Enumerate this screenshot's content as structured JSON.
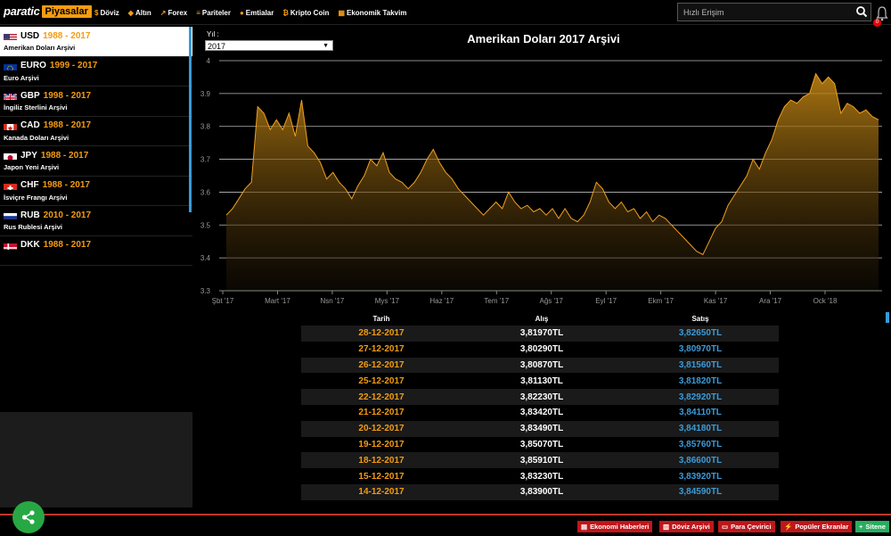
{
  "brand": {
    "part1": "paratic",
    "part2": "Piyasalar"
  },
  "nav": [
    {
      "icon": "dollar-icon",
      "glyph": "$",
      "label": "Döviz"
    },
    {
      "icon": "gold-icon",
      "glyph": "◆",
      "label": "Altın"
    },
    {
      "icon": "forex-icon",
      "glyph": "↗",
      "label": "Forex"
    },
    {
      "icon": "parity-icon",
      "glyph": "≡",
      "label": "Pariteler"
    },
    {
      "icon": "commodity-icon",
      "glyph": "●",
      "label": "Emtialar"
    },
    {
      "icon": "bitcoin-icon",
      "glyph": "₿",
      "label": "Kripto Coin"
    },
    {
      "icon": "calendar-icon",
      "glyph": "▦",
      "label": "Ekonomik Takvim"
    }
  ],
  "search": {
    "placeholder": "Hızlı Erişim"
  },
  "notifications": {
    "count": "0"
  },
  "sidebar": {
    "items": [
      {
        "flag": "us",
        "code": "USD",
        "years": "1988 - 2017",
        "name": "Amerikan Doları Arşivi",
        "active": true
      },
      {
        "flag": "eu",
        "code": "EURO",
        "years": "1999 - 2017",
        "name": "Euro Arşivi"
      },
      {
        "flag": "gb",
        "code": "GBP",
        "years": "1998 - 2017",
        "name": "İngiliz Sterlini Arşivi"
      },
      {
        "flag": "ca",
        "code": "CAD",
        "years": "1988 - 2017",
        "name": "Kanada Doları Arşivi"
      },
      {
        "flag": "jp",
        "code": "JPY",
        "years": "1988 - 2017",
        "name": "Japon Yeni Arşivi"
      },
      {
        "flag": "ch",
        "code": "CHF",
        "years": "1988 - 2017",
        "name": "İsviçre Frangı Arşivi"
      },
      {
        "flag": "ru",
        "code": "RUB",
        "years": "2010 - 2017",
        "name": "Rus Rublesi Arşivi"
      },
      {
        "flag": "dk",
        "code": "DKK",
        "years": "1988 - 2017",
        "name": ""
      }
    ]
  },
  "year_select": {
    "label": "Yıl :",
    "value": "2017"
  },
  "chart_data": {
    "type": "area",
    "title": "Amerikan Doları 2017 Arşivi",
    "ylim": [
      3.3,
      4.0
    ],
    "yticks": [
      "3.3",
      "3.4",
      "3.5",
      "3.6",
      "3.7",
      "3.8",
      "3.9",
      "4"
    ],
    "xticks": [
      "Şbt '17",
      "Mart '17",
      "Nsn '17",
      "Mys '17",
      "Haz '17",
      "Tem '17",
      "Ağs '17",
      "Eyl '17",
      "Ekm '17",
      "Kas '17",
      "Ara '17",
      "Ock '18"
    ],
    "grid": true,
    "series": [
      {
        "values": [
          3.53,
          3.55,
          3.58,
          3.61,
          3.63,
          3.86,
          3.84,
          3.79,
          3.82,
          3.79,
          3.84,
          3.77,
          3.88,
          3.74,
          3.72,
          3.69,
          3.64,
          3.66,
          3.63,
          3.61,
          3.58,
          3.62,
          3.65,
          3.7,
          3.68,
          3.72,
          3.66,
          3.64,
          3.63,
          3.61,
          3.63,
          3.66,
          3.7,
          3.73,
          3.69,
          3.66,
          3.64,
          3.61,
          3.59,
          3.57,
          3.55,
          3.53,
          3.55,
          3.57,
          3.55,
          3.6,
          3.57,
          3.55,
          3.56,
          3.54,
          3.55,
          3.53,
          3.55,
          3.52,
          3.55,
          3.52,
          3.51,
          3.53,
          3.57,
          3.63,
          3.61,
          3.57,
          3.55,
          3.57,
          3.54,
          3.55,
          3.52,
          3.54,
          3.51,
          3.53,
          3.52,
          3.5,
          3.48,
          3.46,
          3.44,
          3.42,
          3.41,
          3.45,
          3.49,
          3.51,
          3.56,
          3.59,
          3.62,
          3.65,
          3.7,
          3.67,
          3.72,
          3.76,
          3.82,
          3.86,
          3.88,
          3.87,
          3.89,
          3.9,
          3.96,
          3.93,
          3.95,
          3.93,
          3.84,
          3.87,
          3.86,
          3.84,
          3.85,
          3.83,
          3.82
        ]
      }
    ]
  },
  "table": {
    "headers": {
      "date": "Tarih",
      "buy": "Alış",
      "sell": "Satış"
    },
    "rows": [
      {
        "date": "28-12-2017",
        "buy": "3,81970TL",
        "sell": "3,82650TL"
      },
      {
        "date": "27-12-2017",
        "buy": "3,80290TL",
        "sell": "3,80970TL"
      },
      {
        "date": "26-12-2017",
        "buy": "3,80870TL",
        "sell": "3,81560TL"
      },
      {
        "date": "25-12-2017",
        "buy": "3,81130TL",
        "sell": "3,81820TL"
      },
      {
        "date": "22-12-2017",
        "buy": "3,82230TL",
        "sell": "3,82920TL"
      },
      {
        "date": "21-12-2017",
        "buy": "3,83420TL",
        "sell": "3,84110TL"
      },
      {
        "date": "20-12-2017",
        "buy": "3,83490TL",
        "sell": "3,84180TL"
      },
      {
        "date": "19-12-2017",
        "buy": "3,85070TL",
        "sell": "3,85760TL"
      },
      {
        "date": "18-12-2017",
        "buy": "3,85910TL",
        "sell": "3,86600TL"
      },
      {
        "date": "15-12-2017",
        "buy": "3,83230TL",
        "sell": "3,83920TL"
      },
      {
        "date": "14-12-2017",
        "buy": "3,83900TL",
        "sell": "3,84590TL"
      }
    ]
  },
  "bottom_links": [
    {
      "icon": "news-icon",
      "label": "Ekonomi Haberleri",
      "color": "#c0161a"
    },
    {
      "icon": "archive-icon",
      "label": "Döviz Arşivi",
      "color": "#c0161a"
    },
    {
      "icon": "converter-icon",
      "label": "Para Çevirici",
      "color": "#c0161a"
    },
    {
      "icon": "flash-icon",
      "label": "Popüler Ekranlar",
      "color": "#c0161a"
    },
    {
      "icon": "plus-icon",
      "label": "Sitene",
      "color": "#27ae60"
    }
  ],
  "colors": {
    "accent": "#f39c12",
    "blue": "#3a9bd9",
    "red": "#c0161a",
    "green": "#27a844"
  }
}
